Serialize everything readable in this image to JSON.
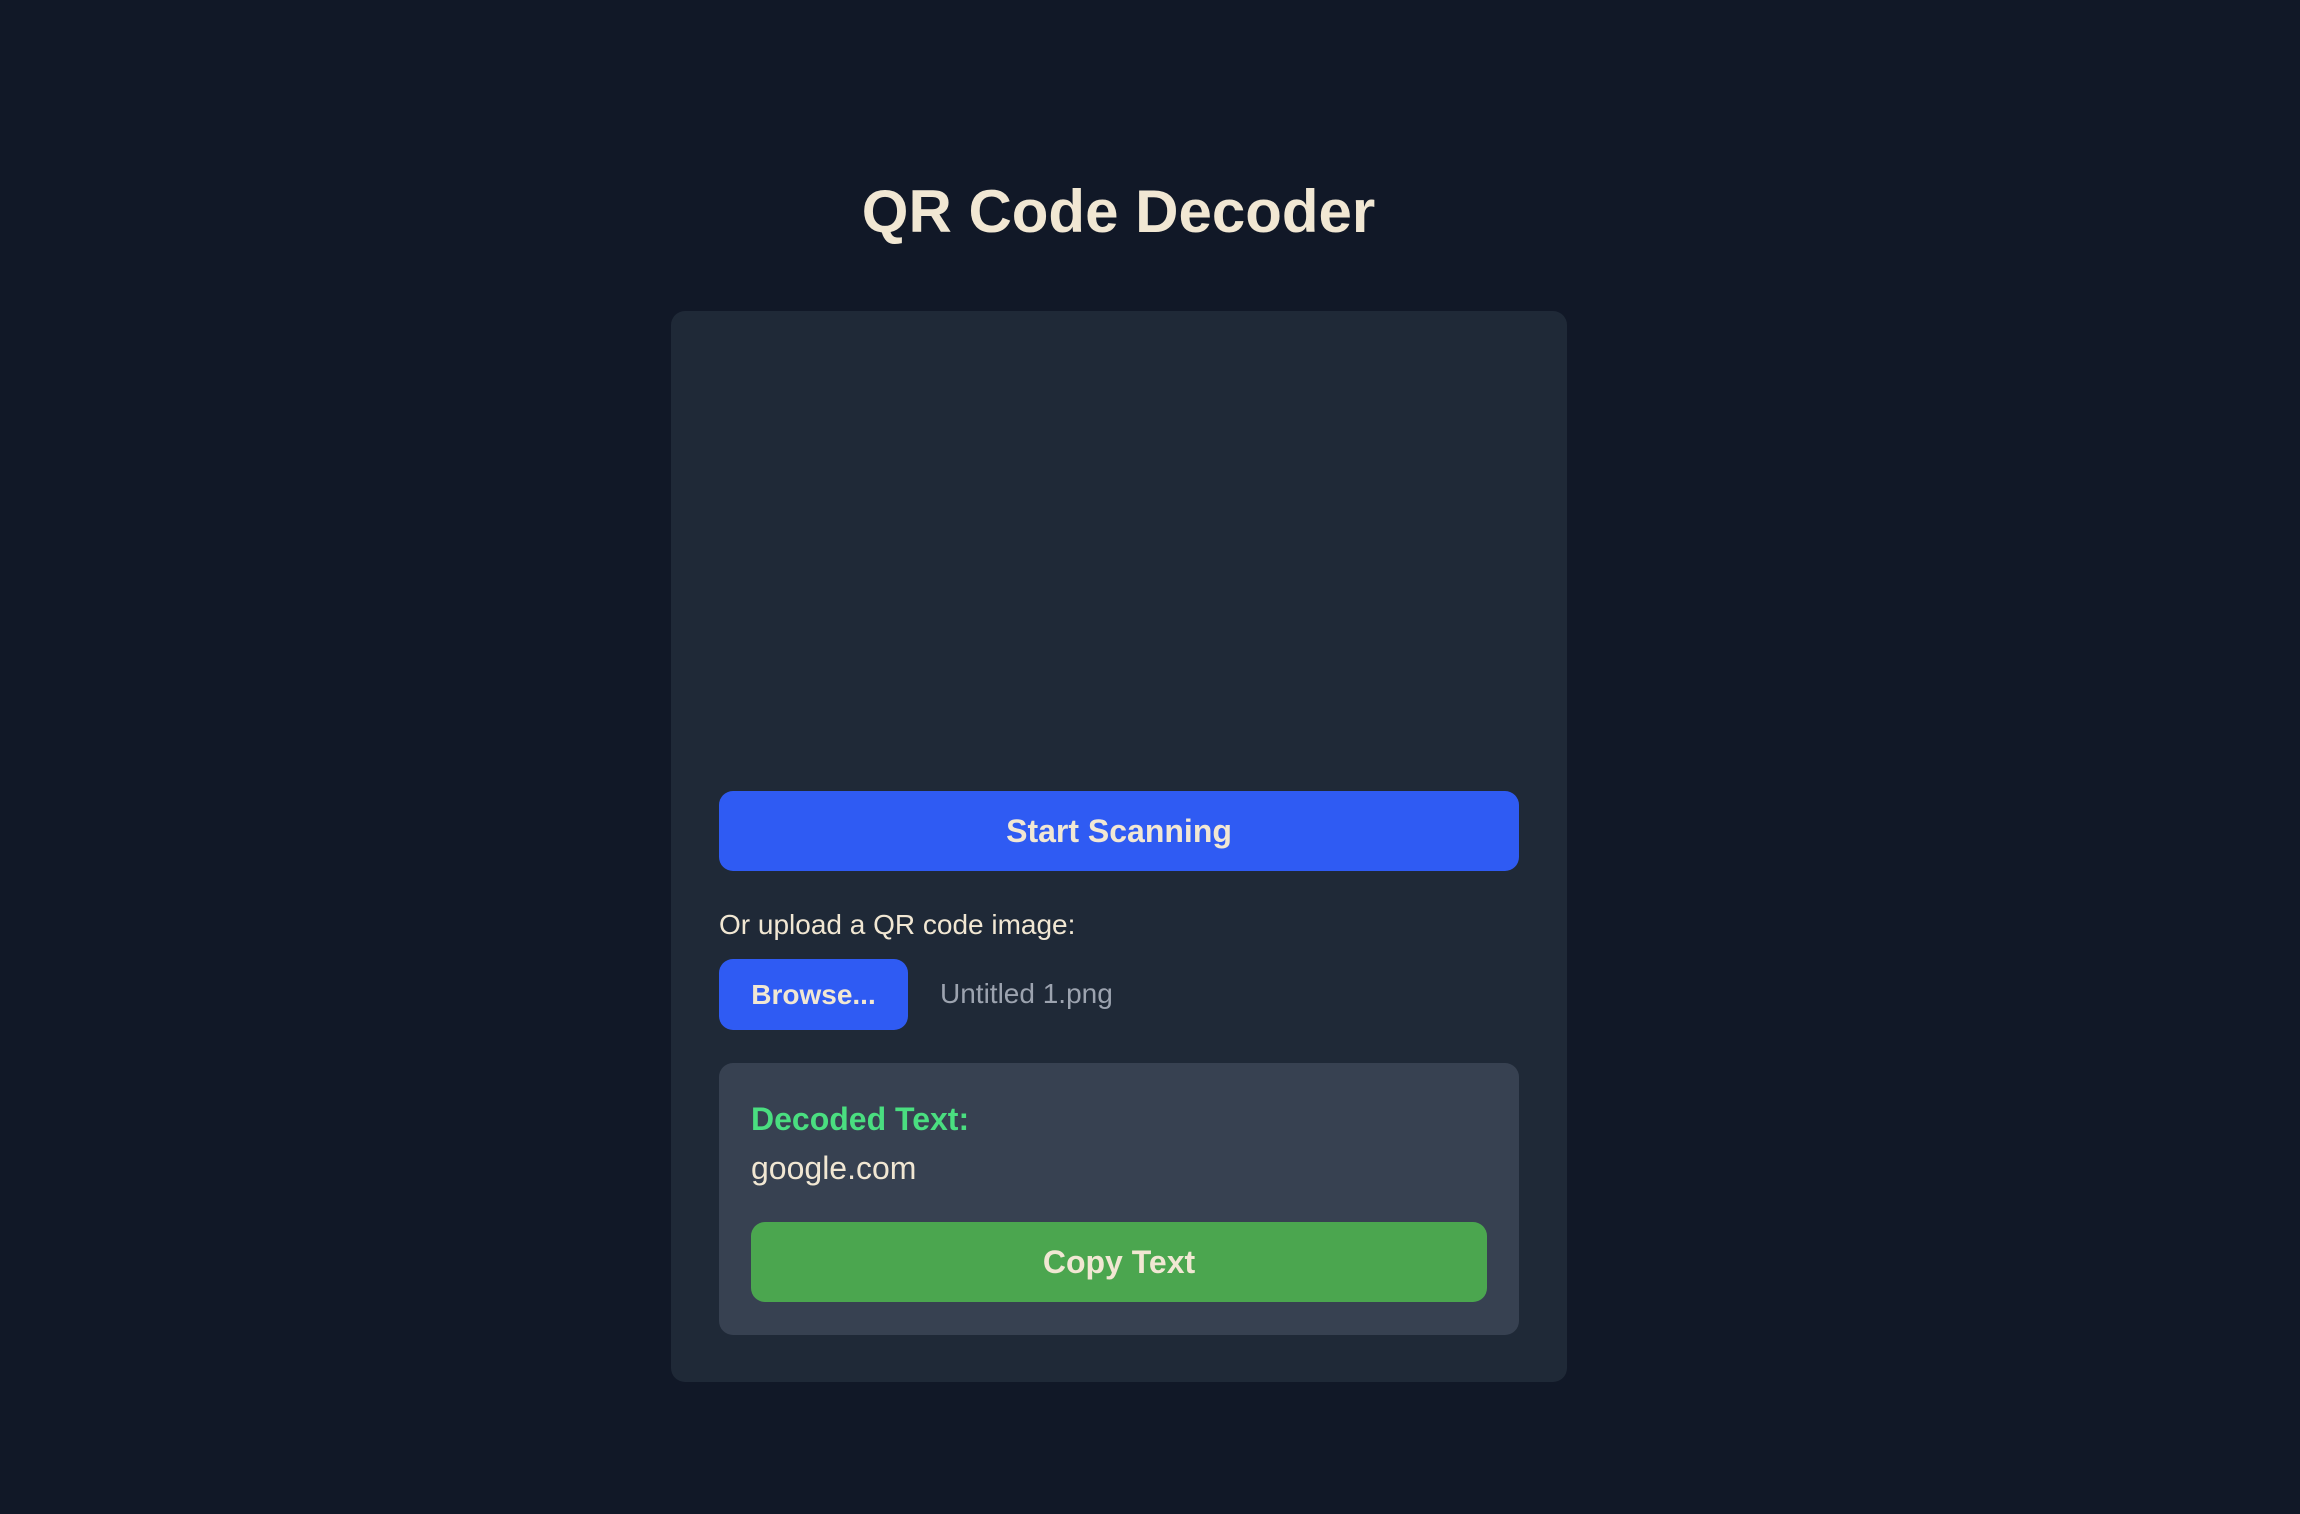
{
  "header": {
    "title": "QR Code Decoder"
  },
  "scanner": {
    "start_label": "Start Scanning"
  },
  "upload": {
    "label": "Or upload a QR code image:",
    "browse_label": "Browse...",
    "file_name": "Untitled 1.png"
  },
  "result": {
    "label": "Decoded Text:",
    "text": "google.com",
    "copy_label": "Copy Text"
  },
  "colors": {
    "background": "#111827",
    "card": "#1f2937",
    "result_panel": "#374151",
    "primary": "#2f5bf3",
    "success": "#4ba64f",
    "success_text": "#4ade80",
    "text": "#f1e7d3",
    "muted_text": "#9ca3af"
  }
}
